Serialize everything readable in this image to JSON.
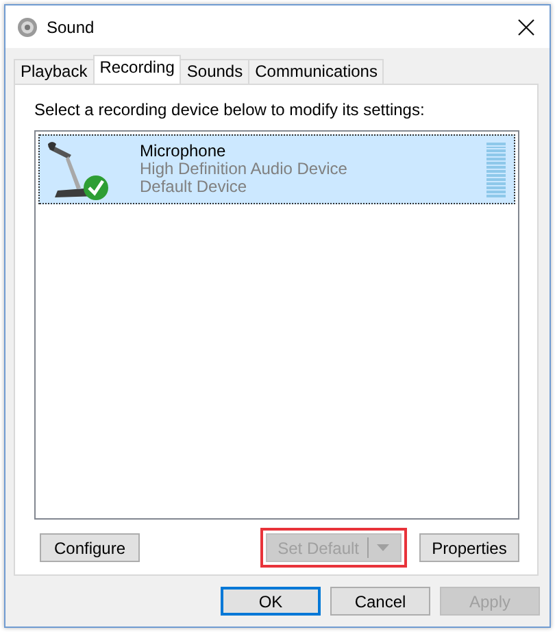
{
  "window": {
    "title": "Sound"
  },
  "tabs": [
    {
      "label": "Playback",
      "selected": false
    },
    {
      "label": "Recording",
      "selected": true
    },
    {
      "label": "Sounds",
      "selected": false
    },
    {
      "label": "Communications",
      "selected": false
    }
  ],
  "instruction": "Select a recording device below to modify its settings:",
  "devices": [
    {
      "name": "Microphone",
      "description": "High Definition Audio Device",
      "status": "Default Device",
      "selected": true,
      "default": true
    }
  ],
  "device_buttons": [
    {
      "label": "Configure",
      "disabled": false,
      "dropdown": false,
      "highlighted": false
    },
    {
      "label": "Set Default",
      "disabled": true,
      "dropdown": true,
      "highlighted": true
    },
    {
      "label": "Properties",
      "disabled": false,
      "dropdown": false,
      "highlighted": false
    }
  ],
  "dialog_buttons": [
    {
      "label": "OK",
      "disabled": false,
      "default": true
    },
    {
      "label": "Cancel",
      "disabled": false,
      "default": false
    },
    {
      "label": "Apply",
      "disabled": true,
      "default": false
    }
  ]
}
